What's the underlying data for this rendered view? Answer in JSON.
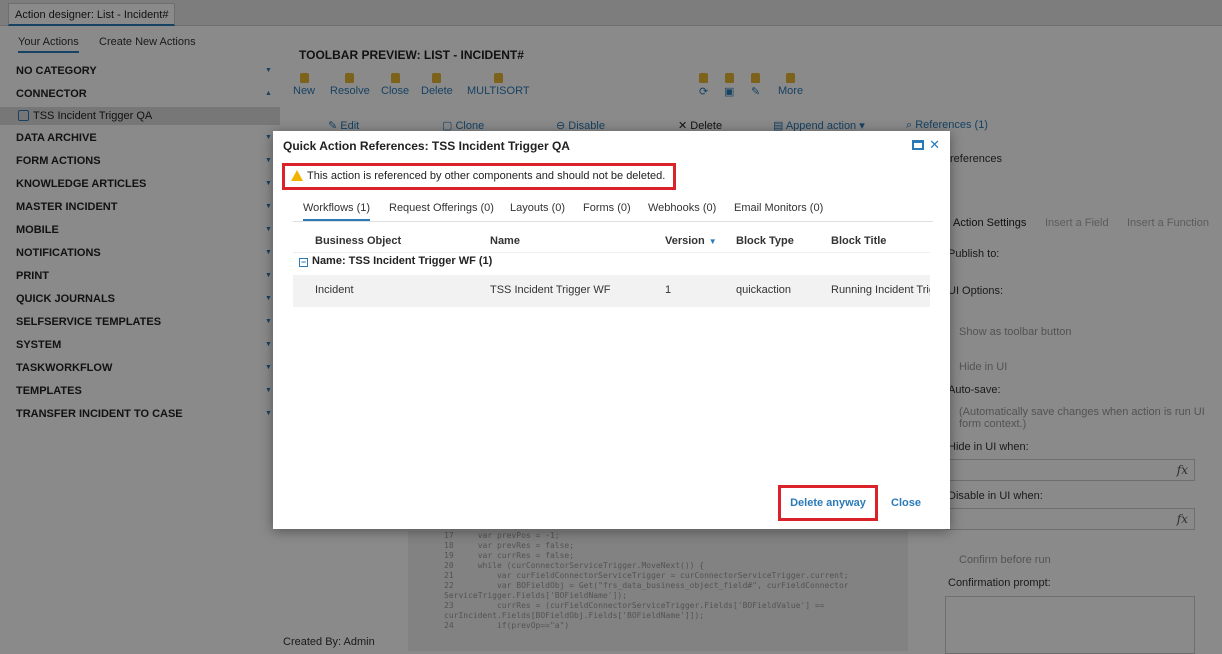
{
  "window": {
    "tab_title": "Action designer: List - Incident#"
  },
  "left": {
    "tabs": [
      "Your Actions",
      "Create New Actions"
    ],
    "categories": [
      "NO CATEGORY",
      "CONNECTOR",
      "DATA ARCHIVE",
      "FORM ACTIONS",
      "KNOWLEDGE ARTICLES",
      "MASTER INCIDENT",
      "MOBILE",
      "NOTIFICATIONS",
      "PRINT",
      "QUICK JOURNALS",
      "SELFSERVICE TEMPLATES",
      "SYSTEM",
      "TASKWORKFLOW",
      "TEMPLATES",
      "TRANSFER INCIDENT TO CASE"
    ],
    "connector_child": "TSS Incident Trigger QA"
  },
  "main": {
    "preview_title": "TOOLBAR PREVIEW: LIST - INCIDENT#",
    "toolbar": [
      "New",
      "Resolve",
      "Close",
      "Delete",
      "MULTISORT"
    ],
    "toolbar_more": "More",
    "actions": [
      "Edit",
      "Clone",
      "Disable",
      "Delete",
      "Append action",
      "References (1)"
    ],
    "references_label": "references",
    "right_tabs": [
      "Action Settings",
      "Insert a Field",
      "Insert a Function"
    ],
    "publish_to": "Publish to:",
    "ui_options": "UI Options:",
    "show_toolbar": "Show as toolbar button",
    "hide_in_ui": "Hide in UI",
    "auto_save": "Auto-save:",
    "auto_save_desc": "(Automatically save changes when action is run UI form context.)",
    "hide_when": "Hide in UI when:",
    "disable_when": "Disable in UI when:",
    "confirm_before": "Confirm before run",
    "confirm_prompt": "Confirmation prompt:",
    "fx": "fx",
    "created_by": "Created By: Admin",
    "code": "17     var prevPos = -1;\n18     var prevRes = false;\n19     var currRes = false;\n20     while (curConnectorServiceTrigger.MoveNext()) {\n21         var curFieldConnectorServiceTrigger = curConnectorServiceTrigger.current;\n22         var BOFieldObj = Get(\"frs_data_business_object_field#\", curFieldConnector\nServiceTrigger.Fields['BOFieldName']);\n23         currRes = (curFieldConnectorServiceTrigger.Fields['BOFieldValue'] ==\ncurIncident.Fields[BOFieldObj.Fields['BOFieldName']]);\n24         if(prevOp==\"a\")"
  },
  "modal": {
    "title": "Quick Action References: TSS Incident Trigger QA",
    "warning": "This action is referenced by other components and should not be deleted.",
    "tabs": [
      "Workflows (1)",
      "Request Offerings (0)",
      "Layouts (0)",
      "Forms (0)",
      "Webhooks (0)",
      "Email Monitors (0)"
    ],
    "columns": [
      "Business Object",
      "Name",
      "Version",
      "Block Type",
      "Block Title"
    ],
    "group_label": "Name: TSS Incident Trigger WF (1)",
    "row": {
      "business_object": "Incident",
      "name": "TSS Incident Trigger WF",
      "version": "1",
      "block_type": "quickaction",
      "block_title": "Running Incident Trig"
    },
    "delete_anyway": "Delete anyway",
    "close": "Close"
  }
}
